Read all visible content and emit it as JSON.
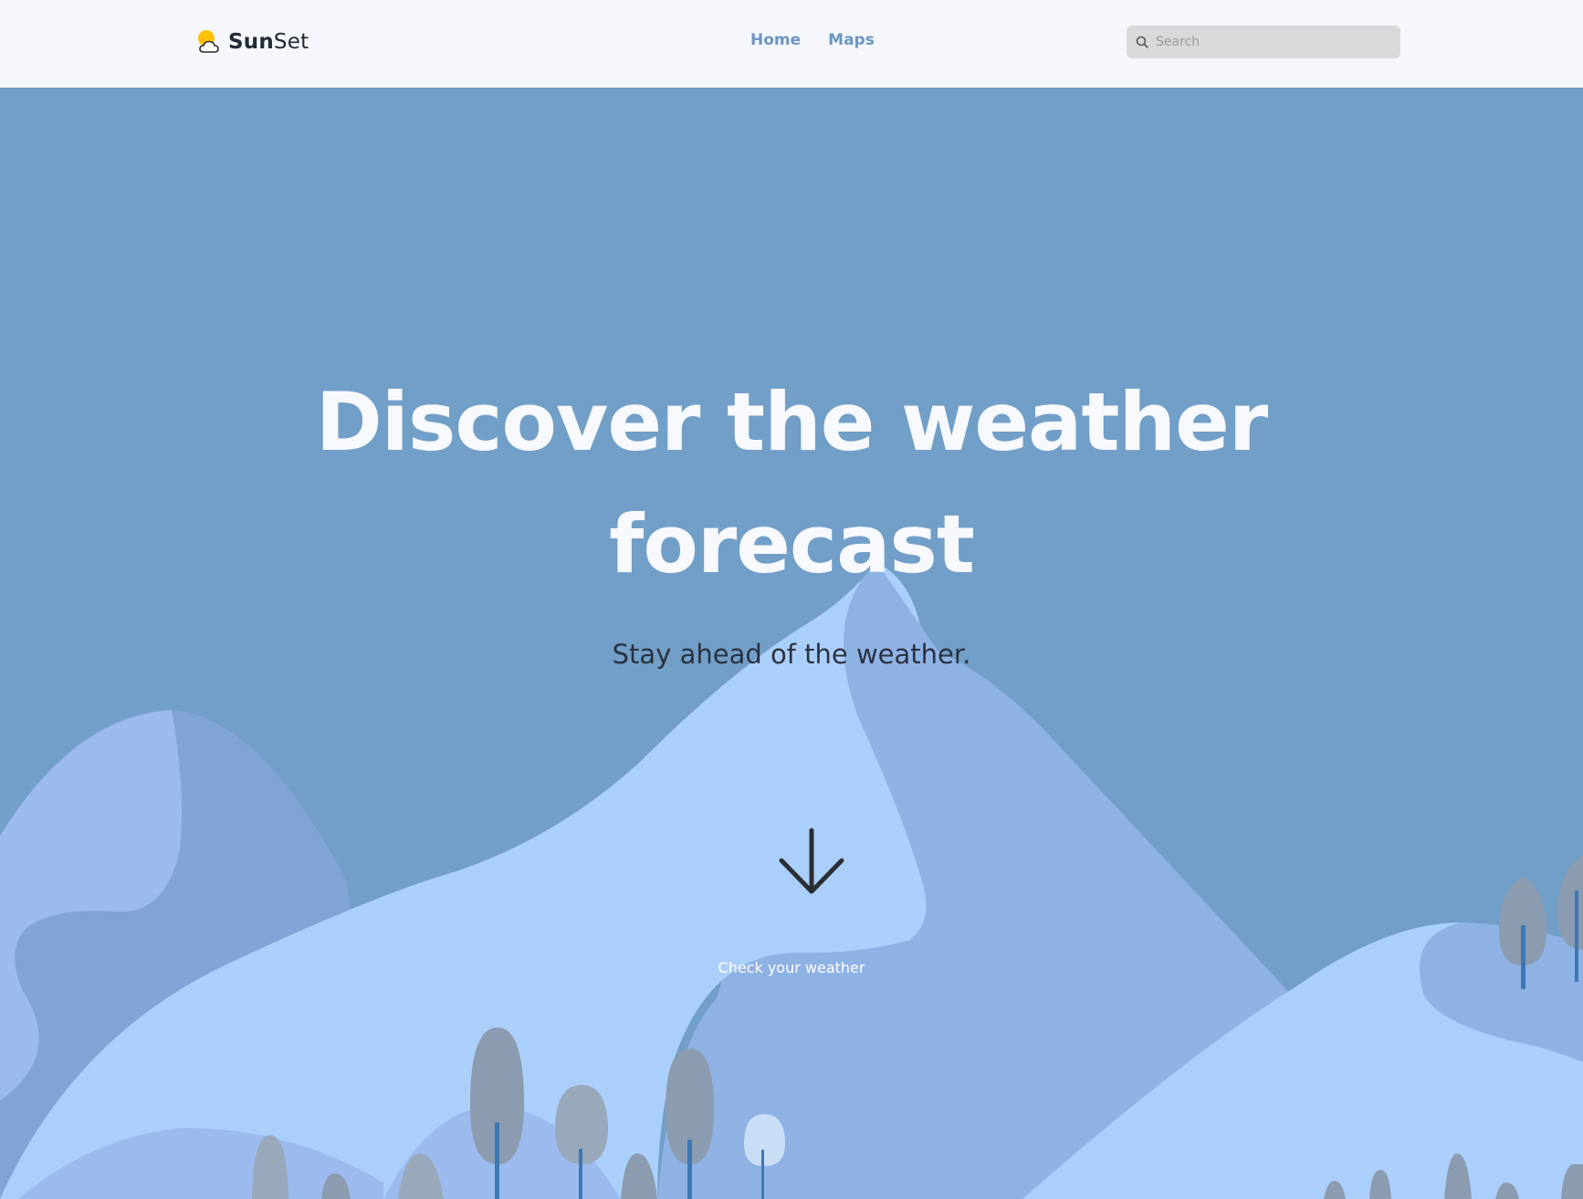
{
  "brand": {
    "name_bold": "Sun",
    "name_rest": "Set",
    "icon": "sun-cloud-icon"
  },
  "nav": {
    "links": [
      {
        "label": "Home"
      },
      {
        "label": "Maps"
      }
    ]
  },
  "search": {
    "placeholder": "Search",
    "value": "",
    "icon": "search-icon"
  },
  "hero": {
    "title_line1": "Discover the weather",
    "title_line2": "forecast",
    "subtitle": "Stay ahead of the weather.",
    "cta_label": "Check your weather",
    "cta_icon": "arrow-down-icon"
  },
  "colors": {
    "nav_bg": "#f5f7fc",
    "nav_link": "#6d96c2",
    "hero_sky": "#719fc8",
    "hill_light": "#abcffb",
    "hill_mid": "#8fb2e5",
    "hill_dark": "#81a4d6",
    "tree_grey": "#8b9bb0",
    "trunk": "#3d78b3",
    "sun": "#ffc107"
  }
}
